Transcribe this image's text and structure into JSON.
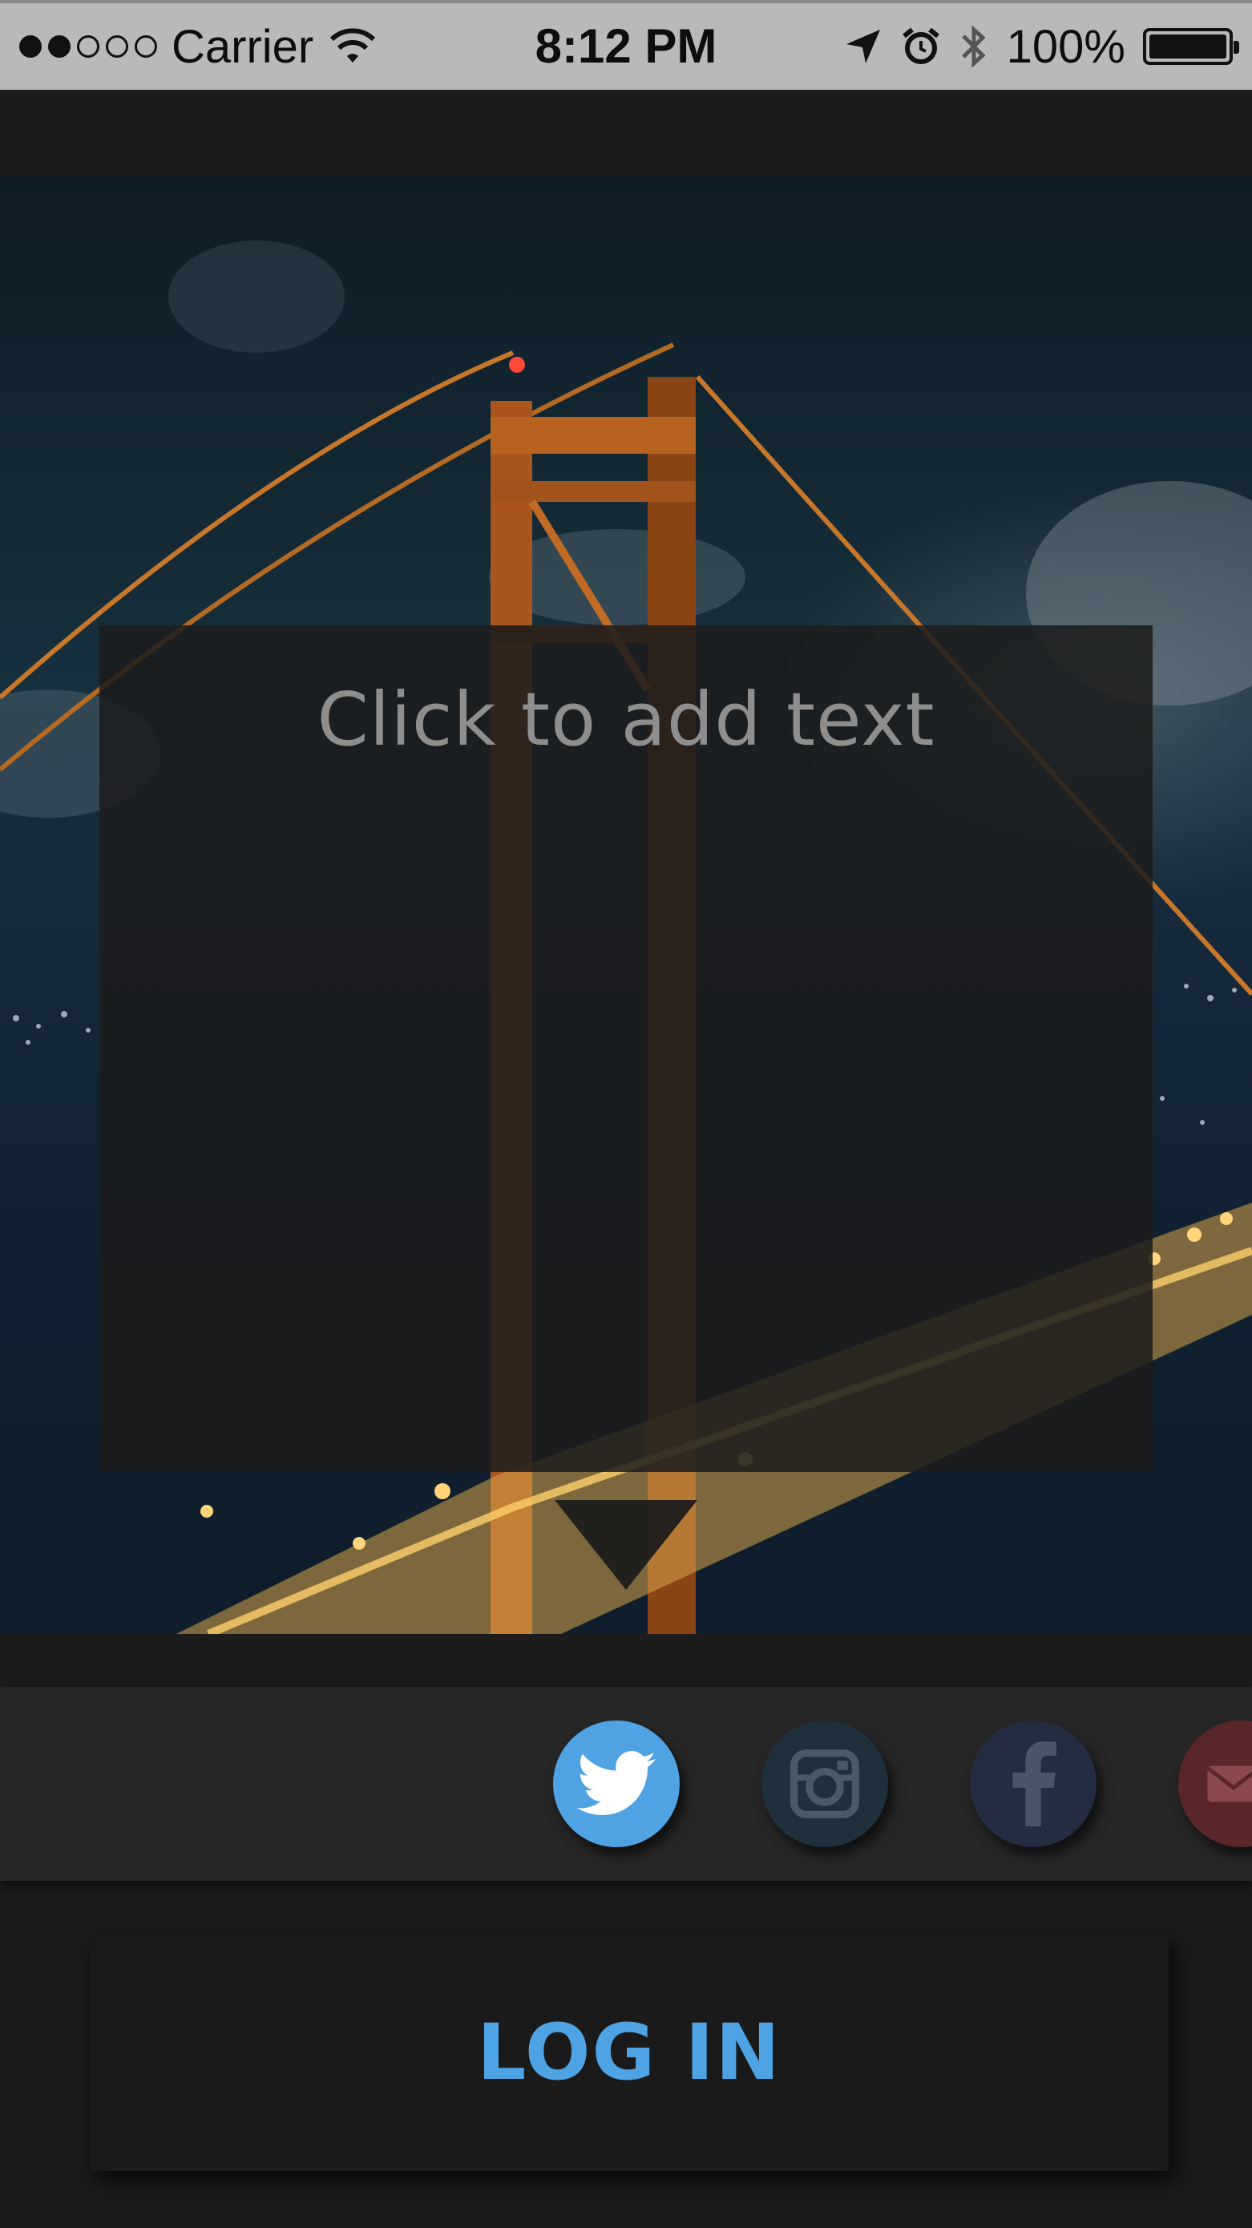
{
  "status_bar": {
    "signal_filled": 2,
    "signal_empty": 3,
    "carrier": "Carrier",
    "time": "8:12 PM",
    "battery_percent": "100%",
    "battery_level": 1.0,
    "icons": [
      "wifi-icon",
      "location-arrow-icon",
      "alarm-icon",
      "bluetooth-icon",
      "battery-icon"
    ]
  },
  "hero": {
    "text_placeholder": "Click to add text"
  },
  "social": {
    "items": [
      {
        "name": "twitter",
        "icon": "twitter-icon",
        "color": "#4fa3e3"
      },
      {
        "name": "instagram",
        "icon": "instagram-icon",
        "color": "#1e303c"
      },
      {
        "name": "facebook",
        "icon": "facebook-icon",
        "color": "#242c42"
      },
      {
        "name": "mail",
        "icon": "mail-icon",
        "color": "#5a2628"
      }
    ]
  },
  "login": {
    "label": "LOG IN",
    "color": "#4ea3e4"
  }
}
